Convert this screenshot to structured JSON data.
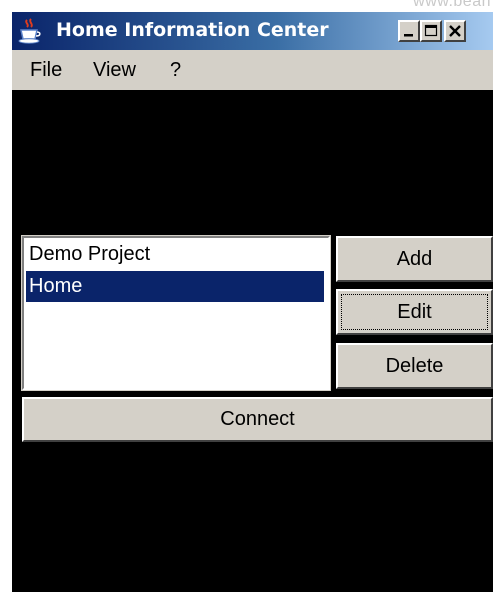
{
  "corner_text": "www.bean",
  "window": {
    "title": "Home Information Center",
    "minimize_label": "minimize",
    "maximize_label": "maximize",
    "close_label": "close"
  },
  "menu": {
    "items": [
      {
        "label": "File"
      },
      {
        "label": "View"
      },
      {
        "label": "?"
      }
    ]
  },
  "projects": {
    "items": [
      {
        "label": "Demo Project",
        "selected": false
      },
      {
        "label": "Home",
        "selected": true
      }
    ]
  },
  "buttons": {
    "add": "Add",
    "edit": "Edit",
    "delete": "Delete",
    "connect": "Connect"
  },
  "colors": {
    "title_gradient_start": "#0a246a",
    "title_gradient_end": "#a6caf0",
    "selection": "#0a246a",
    "content_background": "#000000",
    "face": "#d4d0c8"
  },
  "icons": {
    "app": "java-cup-icon",
    "minimize": "minimize-icon",
    "maximize": "maximize-icon",
    "close": "close-icon"
  }
}
